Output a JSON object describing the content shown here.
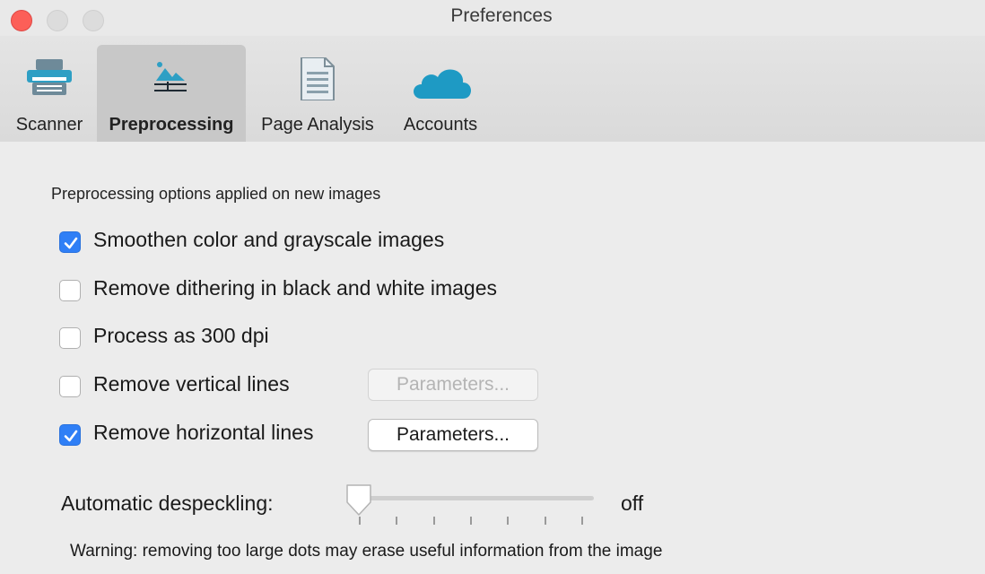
{
  "window": {
    "title": "Preferences"
  },
  "toolbar": {
    "tabs": [
      {
        "label": "Scanner",
        "icon": "scanner-icon",
        "selected": false
      },
      {
        "label": "Preprocessing",
        "icon": "preprocessing-image-icon",
        "selected": true
      },
      {
        "label": "Page Analysis",
        "icon": "document-icon",
        "selected": false
      },
      {
        "label": "Accounts",
        "icon": "cloud-icon",
        "selected": false
      }
    ]
  },
  "preprocessing": {
    "section_label": "Preprocessing options applied on new images",
    "options": [
      {
        "label": "Smoothen color and grayscale images",
        "checked": true
      },
      {
        "label": "Remove dithering in black and white images",
        "checked": false
      },
      {
        "label": "Process as 300 dpi",
        "checked": false
      },
      {
        "label": "Remove vertical lines",
        "checked": false
      },
      {
        "label": "Remove horizontal lines",
        "checked": true
      }
    ],
    "vertical_parameters_label": "Parameters...",
    "vertical_parameters_enabled": false,
    "horizontal_parameters_label": "Parameters...",
    "horizontal_parameters_enabled": true,
    "despeckling": {
      "label": "Automatic despeckling:",
      "value_text": "off",
      "level": 0,
      "tick_count": 7
    },
    "warning": "Warning: removing too large dots may erase useful information from the image"
  },
  "colors": {
    "accent": "#2f7ff6",
    "close": "#fc5f58",
    "cloud": "#1e9ac4"
  }
}
